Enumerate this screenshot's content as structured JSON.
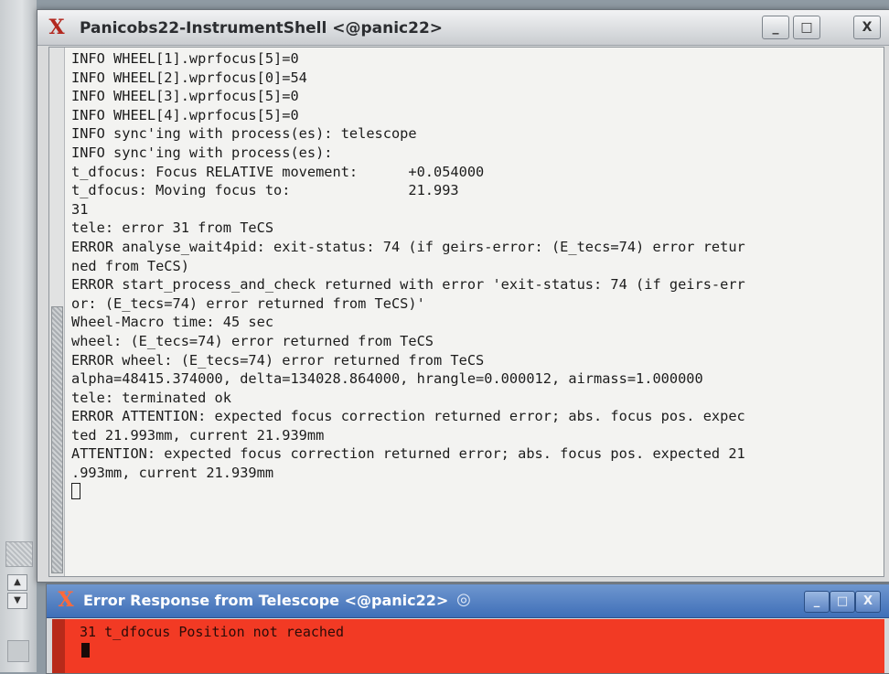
{
  "main_window": {
    "title": "Panicobs22-InstrumentShell <@panic22>",
    "buttons": {
      "minimize": "_",
      "maximize": "□",
      "close": "X"
    },
    "accent_color": "#b3281f",
    "terminal_lines": [
      "INFO WHEEL[1].wprfocus[5]=0",
      "INFO WHEEL[2].wprfocus[0]=54",
      "INFO WHEEL[3].wprfocus[5]=0",
      "INFO WHEEL[4].wprfocus[5]=0",
      "INFO sync'ing with process(es): telescope",
      "INFO sync'ing with process(es):",
      "t_dfocus: Focus RELATIVE movement:      +0.054000",
      "t_dfocus: Moving focus to:              21.993",
      "31",
      "tele: error 31 from TeCS",
      "ERROR analyse_wait4pid: exit-status: 74 (if geirs-error: (E_tecs=74) error retur",
      "ned from TeCS)",
      "ERROR start_process_and_check returned with error 'exit-status: 74 (if geirs-err",
      "or: (E_tecs=74) error returned from TeCS)'",
      "Wheel-Macro time: 45 sec",
      "wheel: (E_tecs=74) error returned from TeCS",
      "ERROR wheel: (E_tecs=74) error returned from TeCS",
      "alpha=48415.374000, delta=134028.864000, hrangle=0.000012, airmass=1.000000",
      "tele: terminated ok",
      "ERROR ATTENTION: expected focus correction returned error; abs. focus pos. expec",
      "ted 21.993mm, current 21.939mm",
      "ATTENTION: expected focus correction returned error; abs. focus pos. expected 21",
      ".993mm, current 21.939mm"
    ]
  },
  "error_window": {
    "title": "Error Response from Telescope <@panic22>",
    "message": "31 t_dfocus Position not reached",
    "buttons": {
      "minimize": "_",
      "maximize": "□",
      "close": "X"
    },
    "body_color": "#f23a24",
    "title_color": "#3f6fb8"
  },
  "desktop": {
    "scroll_up": "▲",
    "scroll_down": "▼"
  }
}
